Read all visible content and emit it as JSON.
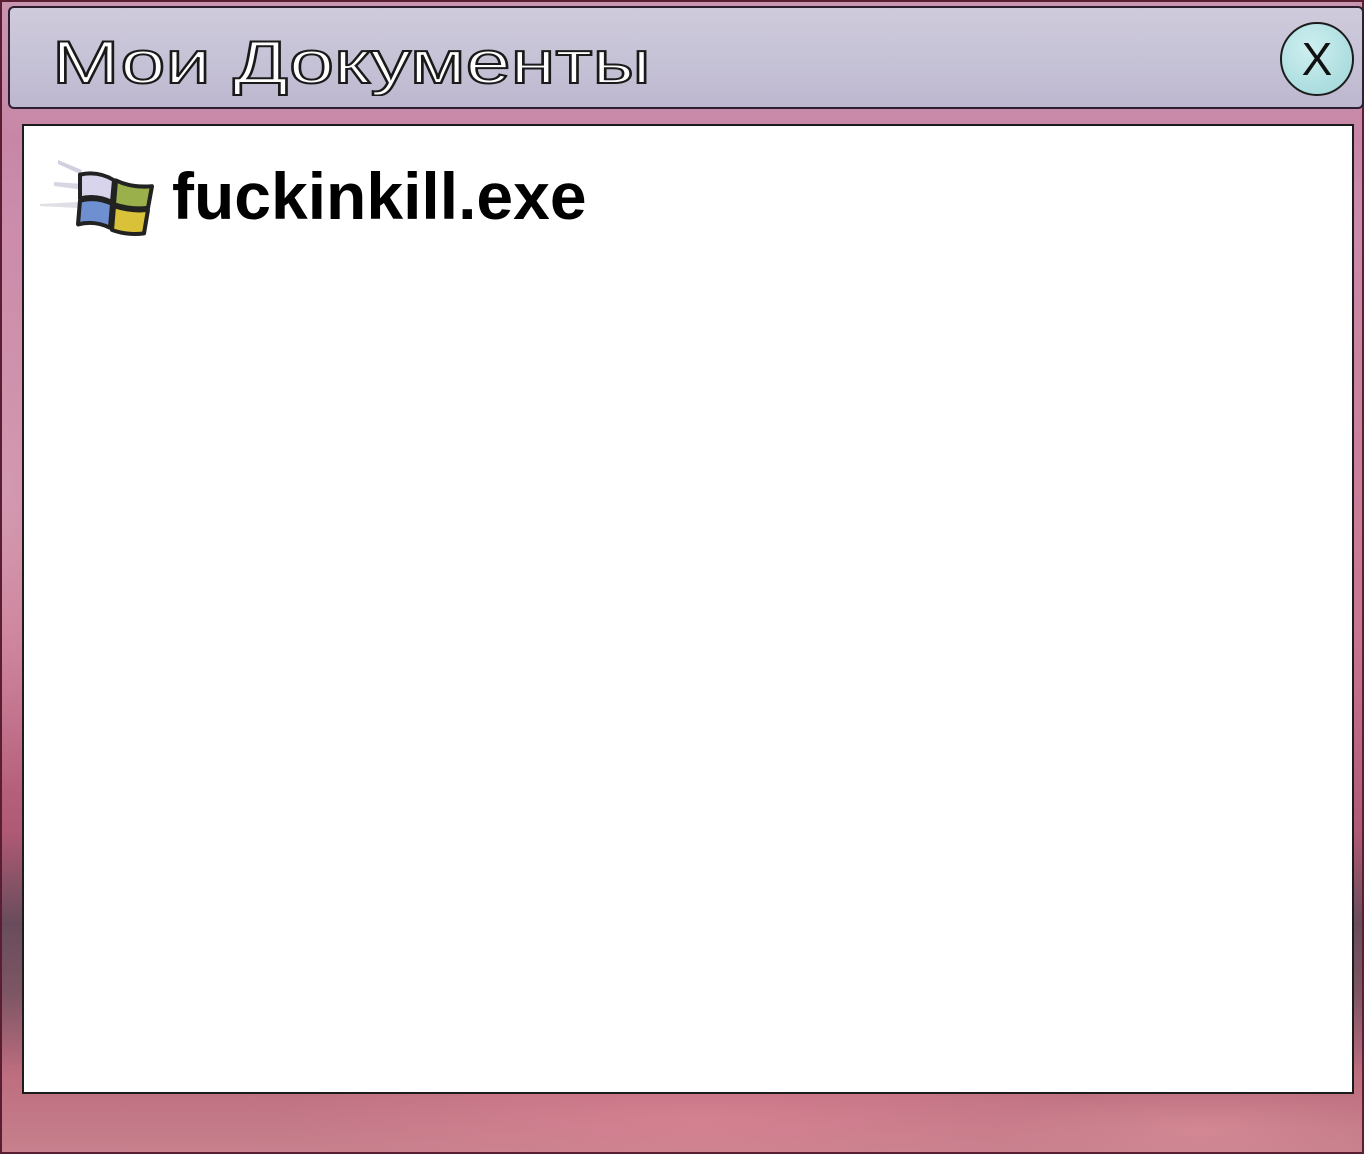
{
  "window": {
    "title": "Мои Документы",
    "close_label": "X"
  },
  "files": [
    {
      "name": "fuckinkill.exe",
      "icon": "windows-flag-icon"
    }
  ],
  "colors": {
    "title_bar": "#c6c2d6",
    "close_button": "#b3e1e3",
    "content_background": "#ffffff",
    "window_border": "#1c1c1c"
  }
}
